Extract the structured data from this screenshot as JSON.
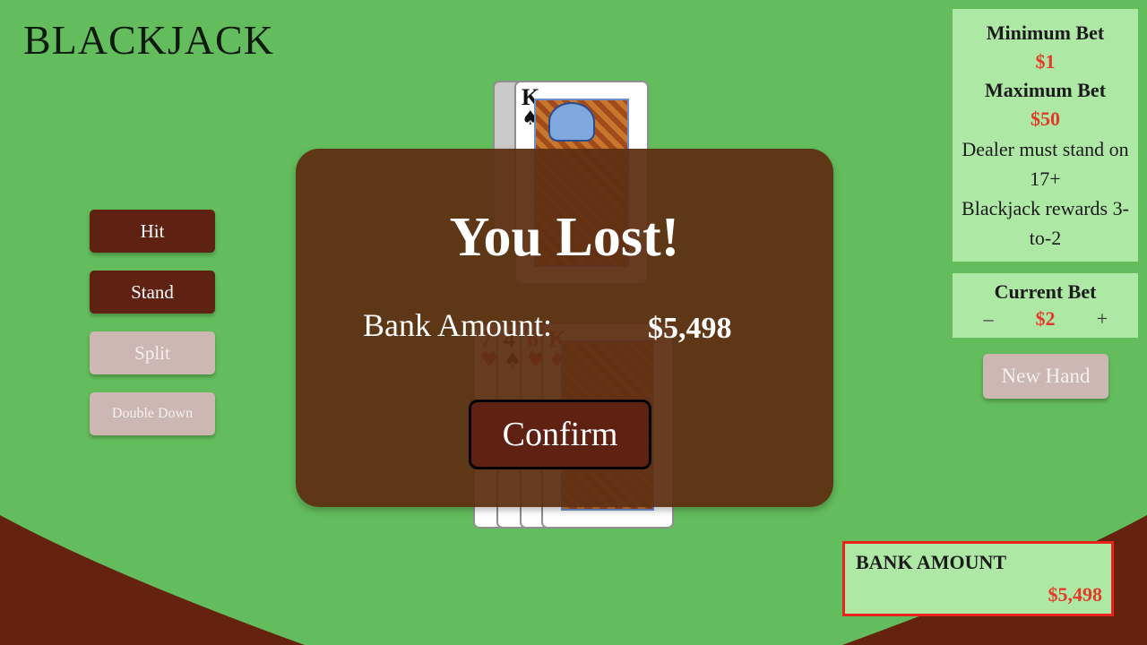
{
  "app": {
    "title": "BLACKJACK"
  },
  "actions": {
    "hit": "Hit",
    "stand": "Stand",
    "split": "Split",
    "double_down": "Double Down"
  },
  "dealer_cards": [
    {
      "rank": "",
      "suit": "",
      "color": "black",
      "hidden": true
    },
    {
      "rank": "K",
      "suit": "♠",
      "color": "black"
    }
  ],
  "player_cards": [
    {
      "rank": "7",
      "suit": "♥",
      "color": "red"
    },
    {
      "rank": "4",
      "suit": "♠",
      "color": "black"
    },
    {
      "rank": "6",
      "suit": "♥",
      "color": "red"
    },
    {
      "rank": "K",
      "suit": "♦",
      "color": "red"
    }
  ],
  "rules": {
    "min_label": "Minimum Bet",
    "min_value": "$1",
    "max_label": "Maximum Bet",
    "max_value": "$50",
    "dealer_rule": "Dealer must stand on 17+",
    "payout_rule": "Blackjack rewards 3-to-2"
  },
  "current_bet": {
    "label": "Current Bet",
    "minus": "–",
    "value": "$2",
    "plus": "+"
  },
  "new_hand": "New Hand",
  "bank": {
    "label": "BANK AMOUNT",
    "value": "$5,498"
  },
  "modal": {
    "title": "You Lost!",
    "bank_label": "Bank Amount:",
    "bank_value": "$5,498",
    "confirm": "Confirm"
  },
  "colors": {
    "felt": "#63bd5c",
    "table_edge": "#65220f",
    "button_active": "#5e2112",
    "button_disabled": "#cdb7b2",
    "panel": "#aee8a5",
    "accent_red": "#e43a2a",
    "modal": "#5d2f12"
  }
}
